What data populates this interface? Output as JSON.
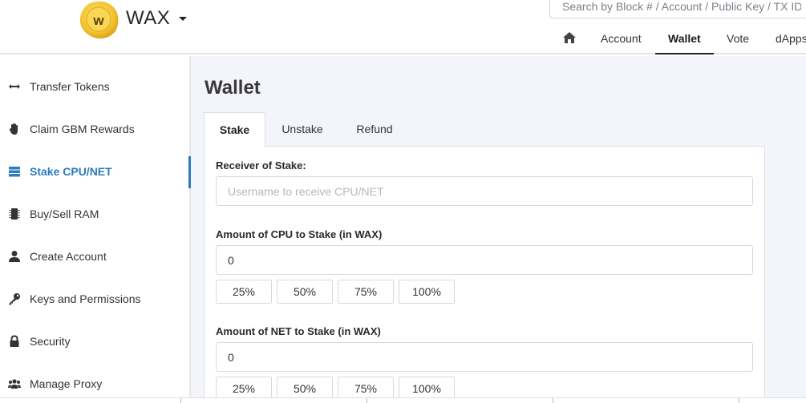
{
  "header": {
    "brand": "WAX",
    "search_placeholder": "Search by Block # / Account / Public Key / TX ID",
    "nav": {
      "home_icon": "home-icon",
      "account": "Account",
      "wallet": "Wallet",
      "vote": "Vote",
      "dapps": "dApps"
    }
  },
  "sidebar": {
    "items": [
      {
        "label": "Transfer Tokens",
        "icon": "arrows-horizontal-icon"
      },
      {
        "label": "Claim GBM Rewards",
        "icon": "hand-icon"
      },
      {
        "label": "Stake CPU/NET",
        "icon": "server-icon",
        "active": true
      },
      {
        "label": "Buy/Sell RAM",
        "icon": "memory-chip-icon"
      },
      {
        "label": "Create Account",
        "icon": "user-icon"
      },
      {
        "label": "Keys and Permissions",
        "icon": "key-icon"
      },
      {
        "label": "Security",
        "icon": "lock-icon"
      },
      {
        "label": "Manage Proxy",
        "icon": "users-icon"
      }
    ]
  },
  "main": {
    "title": "Wallet",
    "tabs": [
      {
        "label": "Stake",
        "active": true
      },
      {
        "label": "Unstake"
      },
      {
        "label": "Refund"
      }
    ],
    "form": {
      "receiver_label": "Receiver of Stake:",
      "receiver_placeholder": "Username to receive CPU/NET",
      "receiver_value": "",
      "cpu_label": "Amount of CPU to Stake (in WAX)",
      "cpu_value": "0",
      "net_label": "Amount of NET to Stake (in WAX)",
      "net_value": "0",
      "percent_buttons": [
        "25%",
        "50%",
        "75%",
        "100%"
      ]
    }
  },
  "colors": {
    "accent": "#2b7bbd",
    "logo_gold": "#f4c433",
    "main_bg": "#f3f5fb"
  }
}
